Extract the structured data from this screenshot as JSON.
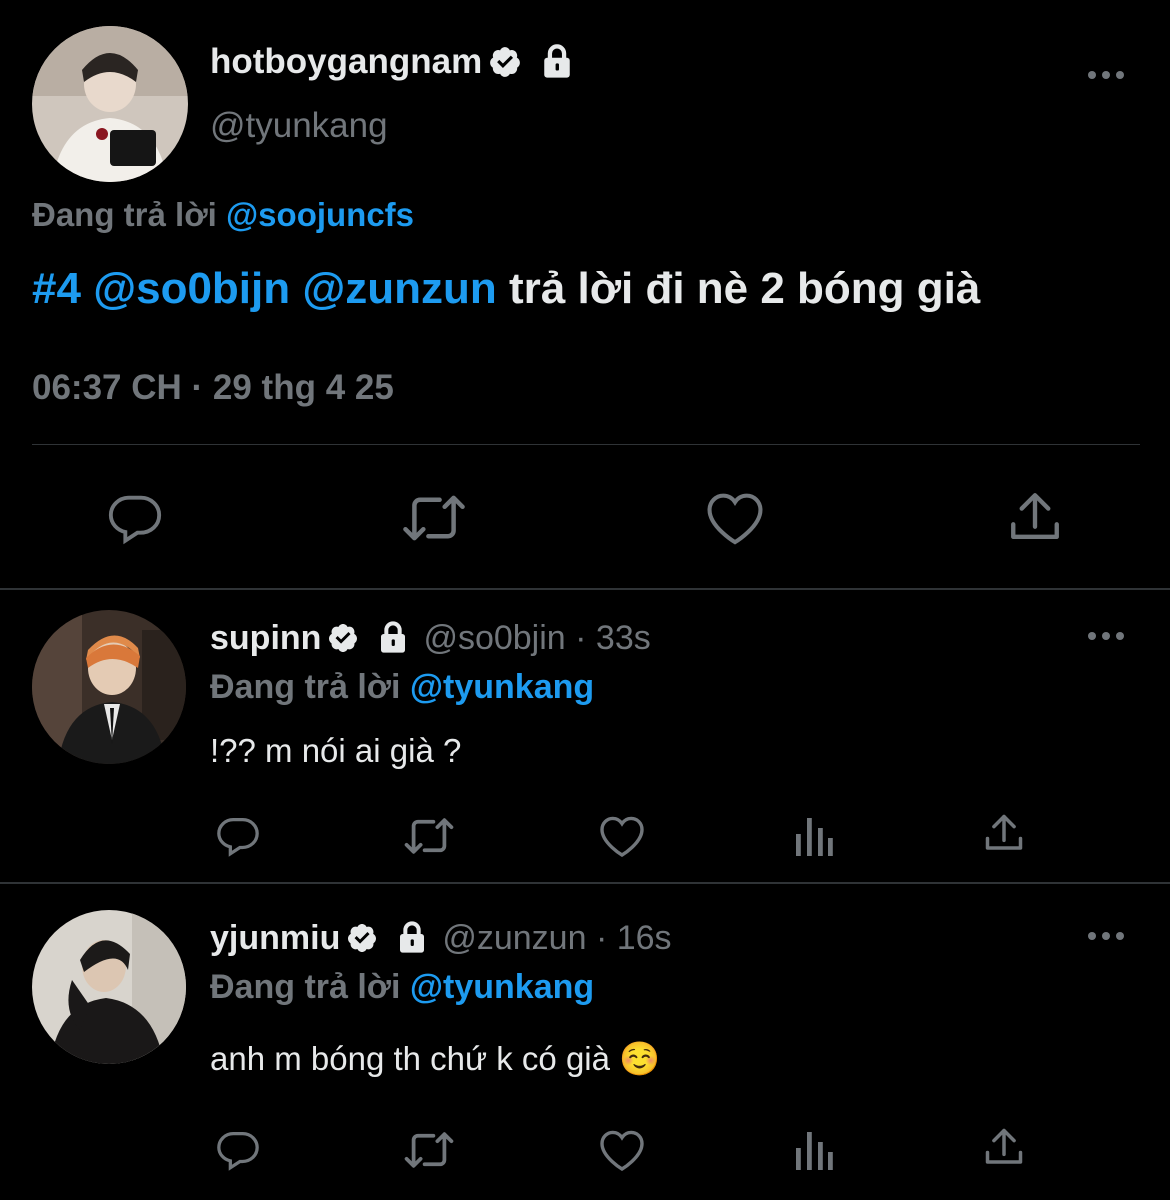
{
  "main_tweet": {
    "display_name": "hotboygangnam",
    "handle": "@tyunkang",
    "reply_prefix": "Đang trả lời",
    "reply_to": "@soojuncfs",
    "text_hashtag": "#4",
    "text_mention1": "@so0bijn",
    "text_mention2": "@zunzun",
    "text_rest": "trả lời đi nè 2 bóng già",
    "timestamp": "06:37 CH · 29 thg 4 25"
  },
  "replies": [
    {
      "display_name": "supinn",
      "handle_time": "@so0bjin · 33s",
      "reply_prefix": "Đang trả lời",
      "reply_to": "@tyunkang",
      "text": "!?? m nói ai già ?"
    },
    {
      "display_name": "yjunmiu",
      "handle_time": "@zunzun · 16s",
      "reply_prefix": "Đang trả lời",
      "reply_to": "@tyunkang",
      "text": "anh m bóng th chứ k có già ☺️"
    }
  ],
  "icons": [
    "verified-icon",
    "lock-icon",
    "more-icon",
    "reply-icon",
    "retweet-icon",
    "like-icon",
    "share-icon",
    "analytics-icon"
  ],
  "colors": {
    "background": "#000000",
    "accent": "#1d9bf0",
    "secondary": "#71767b",
    "primary_text": "#e7e9ea"
  }
}
